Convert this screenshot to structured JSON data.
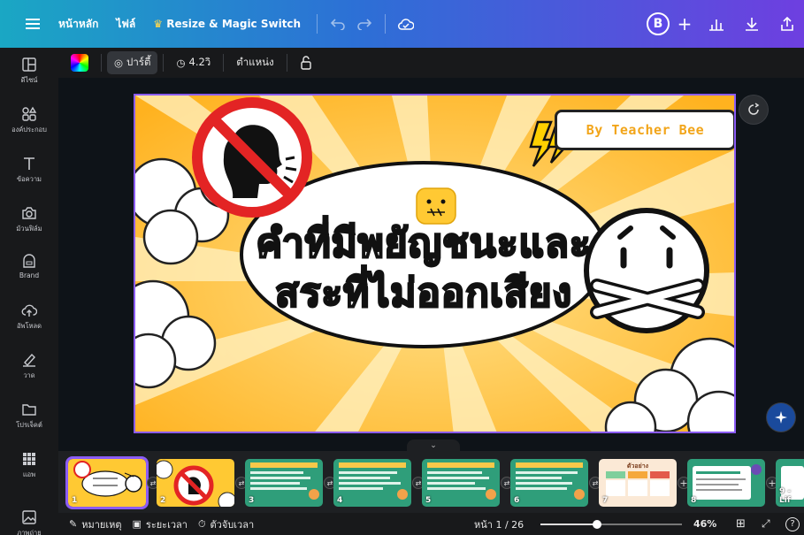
{
  "topbar": {
    "home": "หน้าหลัก",
    "file": "ไฟล์",
    "resize": "Resize & Magic Switch",
    "avatar_initial": "B"
  },
  "rail": {
    "items": [
      {
        "label": "ดีไซน์",
        "icon": "layout-icon"
      },
      {
        "label": "องค์ประกอบ",
        "icon": "shapes-icon"
      },
      {
        "label": "ข้อความ",
        "icon": "text-icon"
      },
      {
        "label": "ม้วนฟิล์ม",
        "icon": "camera-icon"
      },
      {
        "label": "Brand",
        "icon": "brand-icon"
      },
      {
        "label": "อัพโหลด",
        "icon": "upload-cloud-icon"
      },
      {
        "label": "วาด",
        "icon": "draw-icon"
      },
      {
        "label": "โปรเจ็คต์",
        "icon": "folder-icon"
      },
      {
        "label": "แอพ",
        "icon": "apps-grid-icon"
      },
      {
        "label": "ภาพถ่าย",
        "icon": "image-icon"
      }
    ]
  },
  "toolbar2": {
    "party": "ปาร์ตี้",
    "duration": "4.2วิ",
    "position": "ตำแหน่ง"
  },
  "slide": {
    "teacher": "By Teacher Bee",
    "title_line1": "คำที่มีพยัญชนะและ",
    "title_line2": "สระที่ไม่ออกเสียง"
  },
  "film": {
    "thumbs": [
      "1",
      "2",
      "3",
      "4",
      "5",
      "6",
      "7",
      "8",
      "9 - Lif"
    ],
    "slide7_title": "ตัวอย่าง"
  },
  "bottombar": {
    "notes": "หมายเหตุ",
    "duration": "ระยะเวลา",
    "timer": "ตัวจับเวลา",
    "page": "หน้า 1 / 26",
    "zoom": "46%",
    "zoom_fraction": 0.4
  },
  "colors": {
    "accent": "#8b5cf6",
    "slide_yellow": "#ffc933",
    "thumb_green": "#2f9e7a"
  }
}
